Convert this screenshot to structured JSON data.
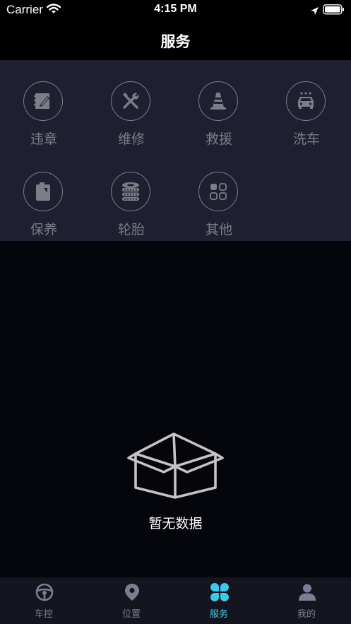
{
  "status_bar": {
    "carrier": "Carrier",
    "time": "4:15 PM"
  },
  "header": {
    "title": "服务"
  },
  "services": [
    {
      "label": "违章",
      "icon": "violation-notebook-icon"
    },
    {
      "label": "维修",
      "icon": "repair-tools-icon"
    },
    {
      "label": "救援",
      "icon": "traffic-cone-icon"
    },
    {
      "label": "洗车",
      "icon": "car-wash-icon"
    },
    {
      "label": "保养",
      "icon": "oil-can-icon"
    },
    {
      "label": "轮胎",
      "icon": "tire-stack-icon"
    },
    {
      "label": "其他",
      "icon": "grid-dots-icon"
    }
  ],
  "empty_state": {
    "text": "暂无数据",
    "icon": "empty-box-icon"
  },
  "tabs": [
    {
      "label": "车控",
      "icon": "steering-wheel-icon",
      "active": false
    },
    {
      "label": "位置",
      "icon": "location-pin-icon",
      "active": false
    },
    {
      "label": "服务",
      "icon": "four-leaf-icon",
      "active": true
    },
    {
      "label": "我的",
      "icon": "user-icon",
      "active": false
    }
  ],
  "colors": {
    "accent": "#3fc9e8",
    "panel": "#1e2031",
    "background": "#05060b",
    "tab_inactive": "#7a8093"
  }
}
